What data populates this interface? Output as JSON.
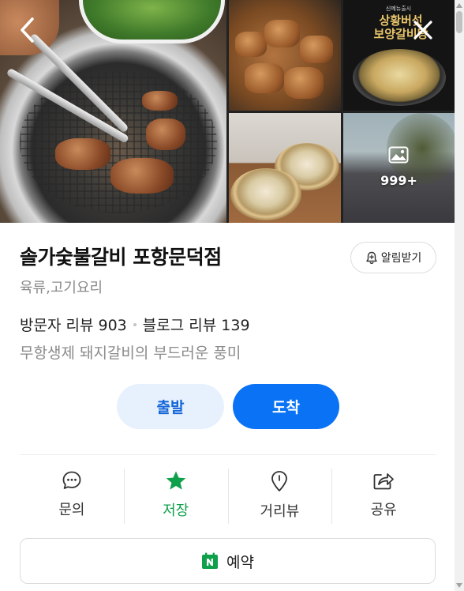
{
  "gallery": {
    "photo_count": "999+",
    "promo_small": "신메뉴출시",
    "promo_title_1": "상황버섯",
    "promo_title_2": "보양갈비탕"
  },
  "place": {
    "name": "솔가숯불갈비 포항문덕점",
    "category": "육류,고기요리",
    "visitor_review_label": "방문자 리뷰",
    "visitor_review_count": "903",
    "blog_review_label": "블로그 리뷰",
    "blog_review_count": "139",
    "description": "무항생제 돼지갈비의 부드러운 풍미"
  },
  "alarm": {
    "label": "알림받기"
  },
  "route": {
    "depart_label": "출발",
    "arrive_label": "도착"
  },
  "actions": [
    {
      "label": "문의",
      "icon": "chat-bubble-icon"
    },
    {
      "label": "저장",
      "icon": "star-icon"
    },
    {
      "label": "거리뷰",
      "icon": "map-pin-icon"
    },
    {
      "label": "공유",
      "icon": "share-icon"
    }
  ],
  "reserve": {
    "label": "예약",
    "icon": "naver-n-calendar-icon"
  },
  "colors": {
    "primary_blue": "#0a73f5",
    "light_blue": "#e7f1fd",
    "saved_green": "#0ea04a",
    "muted_text": "#8a8a8a"
  }
}
